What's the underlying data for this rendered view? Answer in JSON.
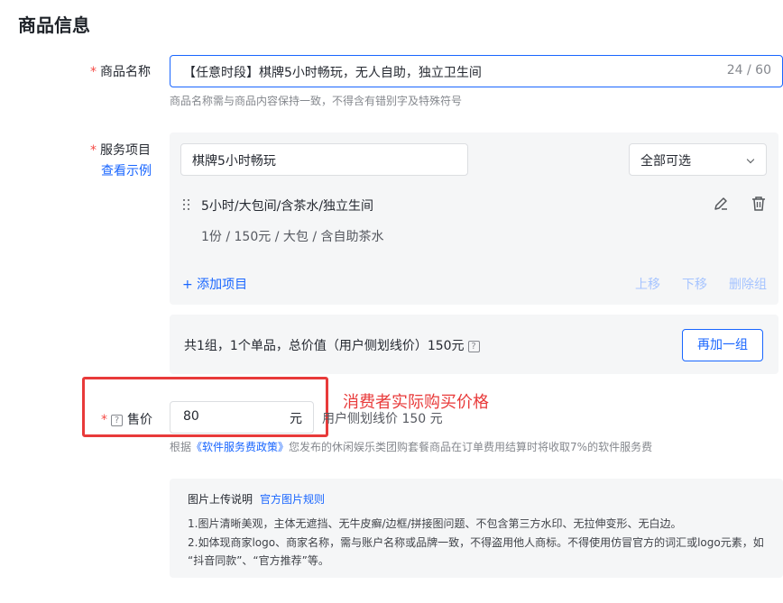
{
  "section": {
    "title": "商品信息"
  },
  "product_name": {
    "label": "商品名称",
    "required_mark": "*",
    "value": "【任意时段】棋牌5小时畅玩，无人自助，独立卫生间",
    "counter": "24 / 60",
    "hint": "商品名称需与商品内容保持一致，不得含有错别字及特殊符号"
  },
  "service": {
    "label": "服务项目",
    "required_mark": "*",
    "example_link": "查看示例",
    "group_name": "棋牌5小时畅玩",
    "select_value": "全部可选",
    "item_title": "5小时/大包间/含茶水/独立生间",
    "item_desc": "1份 / 150元 / 大包 / 含自助茶水",
    "add_item": "+ 添加项目",
    "move_up": "上移",
    "move_down": "下移",
    "delete_group": "删除组"
  },
  "summary": {
    "text": "共1组，1个单品，总价值（用户侧划线价）150元",
    "help_glyph": "?",
    "add_group_button": "再加一组"
  },
  "price": {
    "label": "售价",
    "required_mark": "*",
    "help_glyph": "?",
    "value": "80",
    "unit": "元",
    "line_price": "用户侧划线价 150 元",
    "hint_prefix": "根据",
    "hint_link": "《软件服务费政策》",
    "hint_suffix": "您发布的休闲娱乐类团购套餐商品在订单费用结算时将收取7%的软件服务费"
  },
  "annotation": {
    "text": "消费者实际购买价格"
  },
  "image_rules": {
    "title": "图片上传说明",
    "link": "官方图片规则",
    "line1": "1.图片清晰美观，主体无遮挡、无牛皮癣/边框/拼接图问题、不包含第三方水印、无拉伸变形、无白边。",
    "line2": "2.如体现商家logo、商家名称，需与账户名称或品牌一致，不得盗用他人商标。不得使用仿冒官方的词汇或logo元素，如",
    "line3": "“抖音同款”、“官方推荐”等。"
  },
  "colors": {
    "primary": "#1966ff",
    "required": "#f54a45",
    "annotation": "#e83a3a",
    "panel": "#f5f6f7"
  },
  "icons": [
    "drag-handle-icon",
    "edit-icon",
    "trash-icon",
    "chevron-down-icon",
    "help-icon"
  ]
}
